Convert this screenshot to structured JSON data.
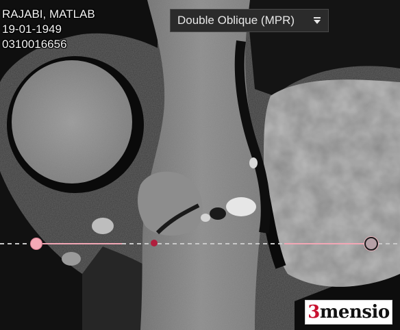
{
  "patient": {
    "name": "RAJABI, MATLAB",
    "dob": "19-01-1949",
    "id": "0310016656"
  },
  "view_selector": {
    "selected": "Double Oblique (MPR)",
    "icon": "dropdown-arrow-icon"
  },
  "branding": {
    "logo_number": "3",
    "logo_word": "mensio"
  },
  "colors": {
    "overlay_line": "#f2a7b5",
    "center_marker": "#b01e3d",
    "logo_red": "#c8102e",
    "panel_bg": "#2b2b2b"
  }
}
